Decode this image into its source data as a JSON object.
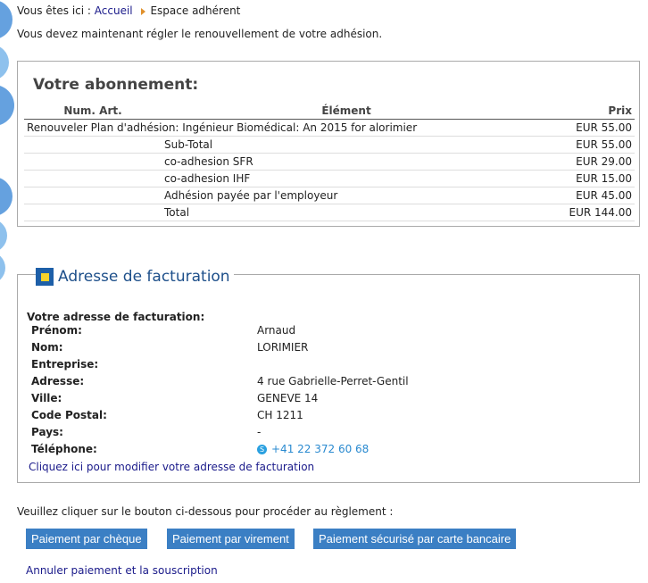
{
  "breadcrumb": {
    "prefix": "Vous êtes ici :",
    "home": "Accueil",
    "current": "Espace adhérent"
  },
  "intro": "Vous devez maintenant régler le renouvellement de votre adhésion.",
  "subscription": {
    "title": "Votre abonnement:",
    "columns": {
      "num": "Num. Art.",
      "item": "Élément",
      "price": "Prix"
    },
    "rows": [
      {
        "item": "Renouveler Plan d'adhésion: Ingénieur Biomédical: An 2015 for alorimier",
        "price": "EUR 55.00",
        "full": true
      },
      {
        "item": "Sub-Total",
        "price": "EUR 55.00"
      },
      {
        "item": "co-adhesion SFR",
        "price": "EUR 29.00"
      },
      {
        "item": "co-adhesion IHF",
        "price": "EUR 15.00"
      },
      {
        "item": "Adhésion payée par l'employeur",
        "price": "EUR 45.00"
      },
      {
        "item": "Total",
        "price": "EUR 144.00"
      }
    ]
  },
  "billing": {
    "header": "Adresse de facturation",
    "subtitle": "Votre adresse de facturation:",
    "fields": [
      {
        "label": "Prénom:",
        "value": "Arnaud"
      },
      {
        "label": "Nom:",
        "value": "LORIMIER"
      },
      {
        "label": "Entreprise:",
        "value": ""
      },
      {
        "label": "Adresse:",
        "value": "4 rue Gabrielle-Perret-Gentil"
      },
      {
        "label": "Ville:",
        "value": "GENEVE 14"
      },
      {
        "label": "Code Postal:",
        "value": "CH 1211"
      },
      {
        "label": "Pays:",
        "value": "-"
      },
      {
        "label": "Téléphone:",
        "value": "+41 22 372 60 68",
        "phone": true
      }
    ],
    "modify_link": "Cliquez ici pour modifier votre adresse de facturation"
  },
  "payment": {
    "intro": "Veuillez cliquer sur le bouton ci-dessous pour procéder au règlement :",
    "buttons": [
      {
        "label": "Paiement par chèque",
        "name": "pay-cheque-button"
      },
      {
        "label": "Paiement par virement",
        "name": "pay-transfer-button"
      },
      {
        "label": "Paiement sécurisé par carte bancaire",
        "name": "pay-card-button"
      }
    ],
    "cancel_link": "Annuler paiement et la souscription"
  },
  "colors": {
    "button": "#3b7fc4",
    "link": "#1a1a8a",
    "header": "#1d4f8a",
    "accent": "#f5d22b"
  }
}
